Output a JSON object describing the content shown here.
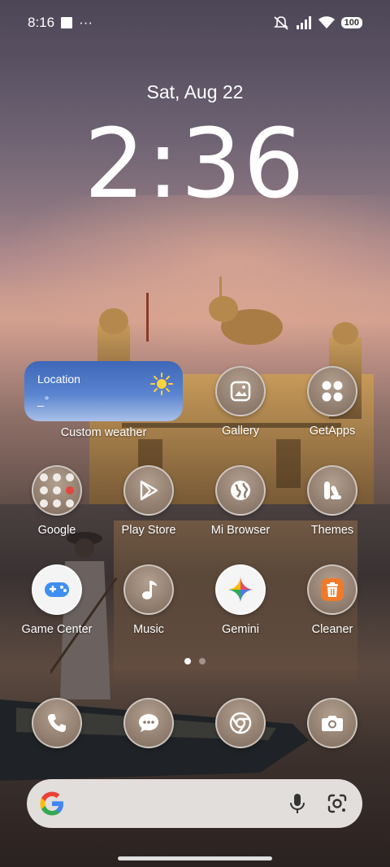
{
  "status_bar": {
    "time": "8:16",
    "more": "···",
    "battery": "100"
  },
  "lock": {
    "date": "Sat, Aug 22",
    "time": "2:36"
  },
  "weather_widget": {
    "location": "Location",
    "temp": "_°",
    "label": "Custom weather"
  },
  "apps": [
    {
      "label": "Gallery"
    },
    {
      "label": "GetApps"
    },
    {
      "label": "Google"
    },
    {
      "label": "Play Store"
    },
    {
      "label": "Mi Browser"
    },
    {
      "label": "Themes"
    },
    {
      "label": "Game Center"
    },
    {
      "label": "Music"
    },
    {
      "label": "Gemini"
    },
    {
      "label": "Cleaner"
    }
  ],
  "dock": [
    "phone-icon",
    "messages-icon",
    "chrome-icon",
    "camera-icon"
  ],
  "colors": {
    "weather_top": "#3e67b8",
    "weather_bottom": "#a9c0e8",
    "cleaner_orange": "#f07a2a",
    "game_center_blue": "#3f8ff0"
  }
}
